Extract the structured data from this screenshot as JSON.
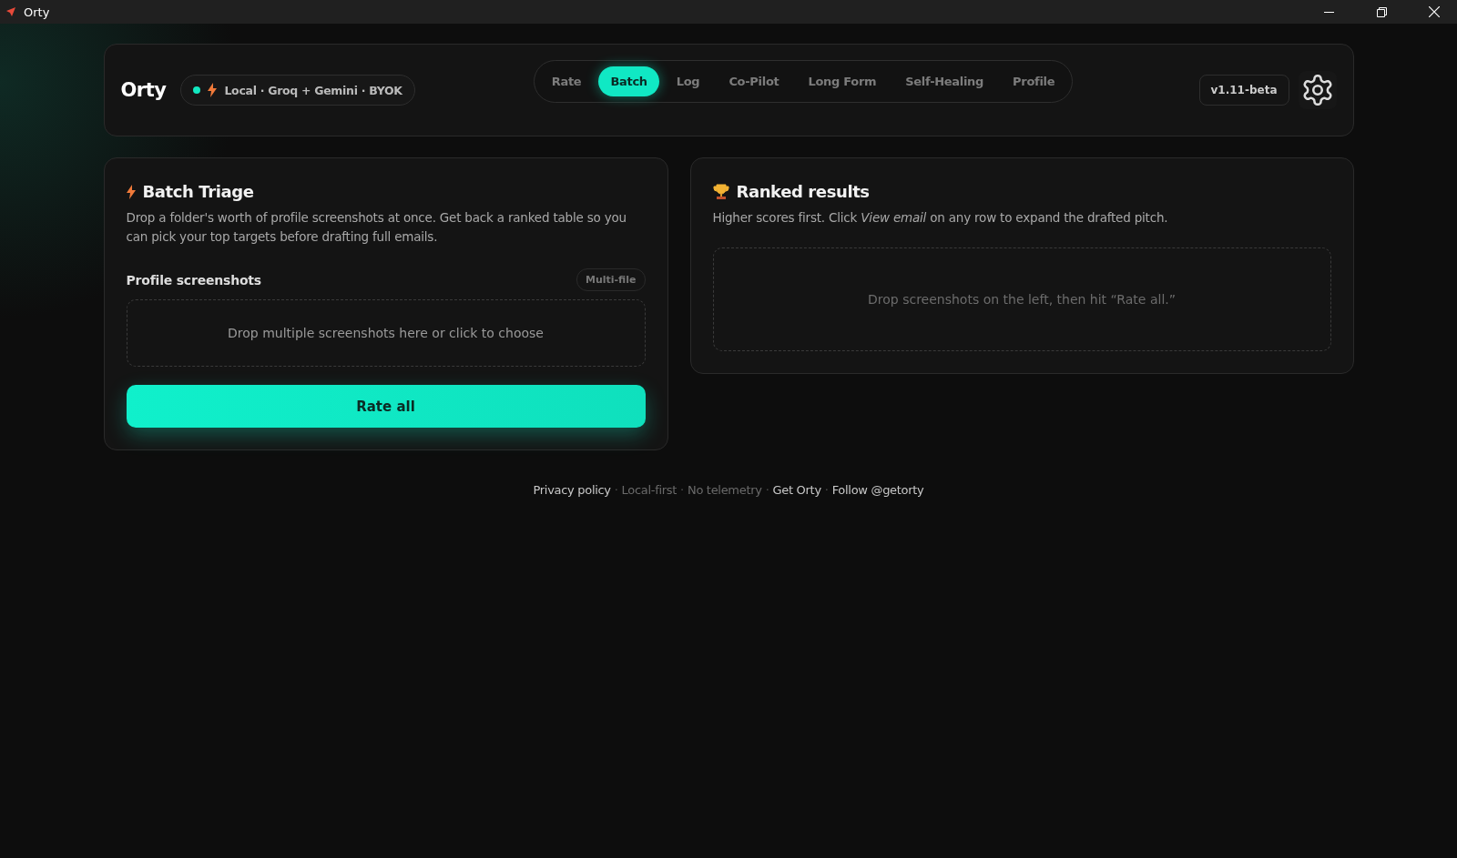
{
  "window": {
    "title": "Orty"
  },
  "header": {
    "brand": "Orty",
    "status": {
      "online": true,
      "text": "Local · Groq + Gemini · BYOK"
    },
    "tabs": [
      {
        "label": "Rate",
        "selected": false
      },
      {
        "label": "Batch",
        "selected": true
      },
      {
        "label": "Log",
        "selected": false
      },
      {
        "label": "Co-Pilot",
        "selected": false
      },
      {
        "label": "Long Form",
        "selected": false
      },
      {
        "label": "Self-Healing",
        "selected": false
      },
      {
        "label": "Profile",
        "selected": false
      }
    ],
    "version": "v1.11-beta"
  },
  "batch": {
    "title": "Batch Triage",
    "description": "Drop a folder's worth of profile screenshots at once. Get back a ranked table so you can pick your top targets before drafting full emails.",
    "field_label": "Profile screenshots",
    "badge": "Multi-file",
    "dropzone": "Drop multiple screenshots here or click to choose",
    "button": "Rate all"
  },
  "results": {
    "title": "Ranked results",
    "description": "Higher scores first. Click *View email* on any row to expand the drafted pitch.",
    "empty": "Drop screenshots on the left, then hit “Rate all.”"
  },
  "footer": [
    {
      "kind": "link",
      "text": "Privacy policy"
    },
    {
      "kind": "separator",
      "text": "·"
    },
    {
      "kind": "text",
      "text": "Local-first"
    },
    {
      "kind": "separator",
      "text": "·"
    },
    {
      "kind": "text",
      "text": "No telemetry"
    },
    {
      "kind": "separator",
      "text": "·"
    },
    {
      "kind": "link",
      "text": "Get Orty"
    },
    {
      "kind": "separator",
      "text": "·"
    },
    {
      "kind": "link",
      "text": "Follow @getorty"
    }
  ]
}
